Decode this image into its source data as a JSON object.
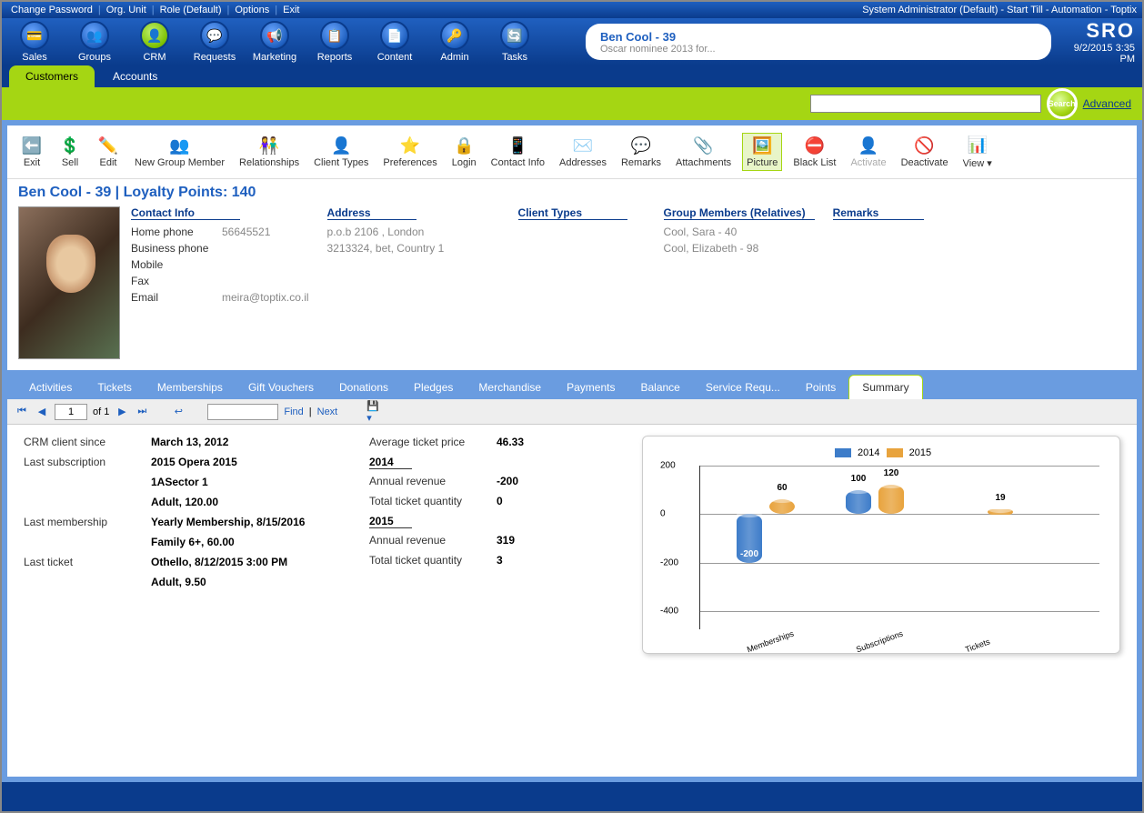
{
  "menubar": {
    "items": [
      "Change Password",
      "Org. Unit",
      "Role (Default)",
      "Options",
      "Exit"
    ],
    "right": "System Administrator (Default) - Start Till - Automation - Toptix"
  },
  "maintoolbar": {
    "buttons": [
      {
        "label": "Sales",
        "icon": "💳"
      },
      {
        "label": "Groups",
        "icon": "👥"
      },
      {
        "label": "CRM",
        "icon": "👤",
        "active": true
      },
      {
        "label": "Requests",
        "icon": "💬"
      },
      {
        "label": "Marketing",
        "icon": "📢"
      },
      {
        "label": "Reports",
        "icon": "📋"
      },
      {
        "label": "Content",
        "icon": "📄"
      },
      {
        "label": "Admin",
        "icon": "🔑"
      },
      {
        "label": "Tasks",
        "icon": "🔄"
      }
    ],
    "search": {
      "title": "Ben Cool - 39",
      "sub": "Oscar nominee 2013 for..."
    },
    "brand": {
      "logo": "SRO",
      "datetime": "9/2/2015 3:35 PM"
    }
  },
  "modtabs": [
    {
      "label": "Customers",
      "active": true
    },
    {
      "label": "Accounts"
    }
  ],
  "searchstrip": {
    "searchBtn": "Search",
    "advanced": "Advanced"
  },
  "actiontoolbar": [
    {
      "label": "Exit",
      "icon": "⬅️"
    },
    {
      "label": "Sell",
      "icon": "💲"
    },
    {
      "label": "Edit",
      "icon": "✏️"
    },
    {
      "label": "New Group Member",
      "icon": "👥"
    },
    {
      "label": "Relationships",
      "icon": "👫"
    },
    {
      "label": "Client Types",
      "icon": "👤"
    },
    {
      "label": "Preferences",
      "icon": "⭐"
    },
    {
      "label": "Login",
      "icon": "🔒"
    },
    {
      "label": "Contact Info",
      "icon": "📱"
    },
    {
      "label": "Addresses",
      "icon": "✉️"
    },
    {
      "label": "Remarks",
      "icon": "💬"
    },
    {
      "label": "Attachments",
      "icon": "📎"
    },
    {
      "label": "Picture",
      "icon": "🖼️",
      "selected": true
    },
    {
      "label": "Black List",
      "icon": "⛔"
    },
    {
      "label": "Activate",
      "icon": "👤",
      "disabled": true
    },
    {
      "label": "Deactivate",
      "icon": "🚫"
    },
    {
      "label": "View ▾",
      "icon": "📊"
    }
  ],
  "customer": {
    "title": "Ben Cool - 39 | Loyalty Points: 140",
    "contact": {
      "header": "Contact Info",
      "rows": [
        {
          "k": "Home phone",
          "v": "56645521"
        },
        {
          "k": "Business phone",
          "v": ""
        },
        {
          "k": "Mobile",
          "v": ""
        },
        {
          "k": "Fax",
          "v": ""
        },
        {
          "k": "Email",
          "v": "meira@toptix.co.il"
        }
      ]
    },
    "address": {
      "header": "Address",
      "lines": [
        "p.o.b 2106 , London",
        "3213324, bet, Country 1"
      ]
    },
    "clientTypes": {
      "header": "Client Types"
    },
    "groupMembers": {
      "header": "Group Members (Relatives)",
      "lines": [
        "Cool, Sara - 40",
        "Cool, Elizabeth - 98"
      ]
    },
    "remarks": {
      "header": "Remarks"
    }
  },
  "detailtabs": [
    "Activities",
    "Tickets",
    "Memberships",
    "Gift Vouchers",
    "Donations",
    "Pledges",
    "Merchandise",
    "Payments",
    "Balance",
    "Service Requ...",
    "Points",
    "Summary"
  ],
  "detailtabs_active": "Summary",
  "report_nav": {
    "page": "1",
    "of": "of 1",
    "find": "Find",
    "next": "Next"
  },
  "summary": {
    "left": [
      {
        "k": "CRM client since",
        "v": "March 13, 2012"
      },
      {
        "k": "Last subscription",
        "v": "2015 Opera  2015"
      },
      {
        "k": "",
        "v": "1ASector 1"
      },
      {
        "k": "",
        "v": "Adult, 120.00"
      },
      {
        "k": "Last membership",
        "v": "Yearly Membership, 8/15/2016"
      },
      {
        "k": "",
        "v": "Family 6+, 60.00"
      },
      {
        "k": "Last ticket",
        "v": "Othello,  8/12/2015 3:00 PM"
      },
      {
        "k": "",
        "v": "Adult, 9.50"
      }
    ],
    "right": [
      {
        "k": "Average ticket price",
        "v": "46.33"
      },
      {
        "year": "2014"
      },
      {
        "k": "Annual revenue",
        "v": "-200"
      },
      {
        "k": "Total ticket quantity",
        "v": "0"
      },
      {
        "year": "2015"
      },
      {
        "k": "Annual revenue",
        "v": "319"
      },
      {
        "k": "Total ticket quantity",
        "v": "3"
      }
    ]
  },
  "chart_data": {
    "type": "bar",
    "categories": [
      "Memberships",
      "Subscriptions",
      "Tickets"
    ],
    "series": [
      {
        "name": "2014",
        "values": [
          -200,
          100,
          0
        ],
        "color": "#3d7cc9"
      },
      {
        "name": "2015",
        "values": [
          60,
          120,
          19
        ],
        "color": "#e8a33d"
      }
    ],
    "ylim": [
      -400,
      200
    ],
    "ticks": [
      -400,
      -200,
      0,
      200
    ]
  }
}
